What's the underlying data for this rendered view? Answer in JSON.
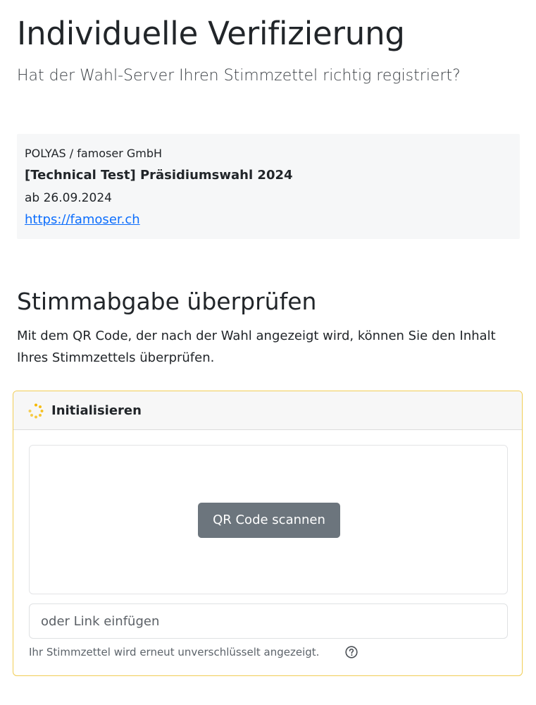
{
  "header": {
    "title": "Individuelle Verifizierung",
    "subtitle": "Hat der Wahl-Server Ihren Stimmzettel richtig registriert?"
  },
  "election_info": {
    "organizer": "POLYAS / famoser GmbH",
    "election_name": "[Technical Test] Präsidiumswahl 2024",
    "date": "ab 26.09.2024",
    "link": "https://famoser.ch"
  },
  "section": {
    "title": "Stimmabgabe überprüfen",
    "description": "Mit dem QR Code, der nach der Wahl angezeigt wird, können Sie den Inhalt Ihres Stimmzettels überprüfen."
  },
  "verification_card": {
    "status": "Initialisieren",
    "status_icon": "spinner-icon",
    "accent_color": "#f1cd55",
    "scan_button_label": "QR Code scannen",
    "link_input_placeholder": "oder Link einfügen",
    "hint": "Ihr Stimmzettel wird erneut unverschlüsselt angezeigt.",
    "hint_icon": "question-circle-icon"
  },
  "colors": {
    "link": "#0d6efd",
    "button": "#6c757d",
    "spinner": "#f5b800"
  }
}
